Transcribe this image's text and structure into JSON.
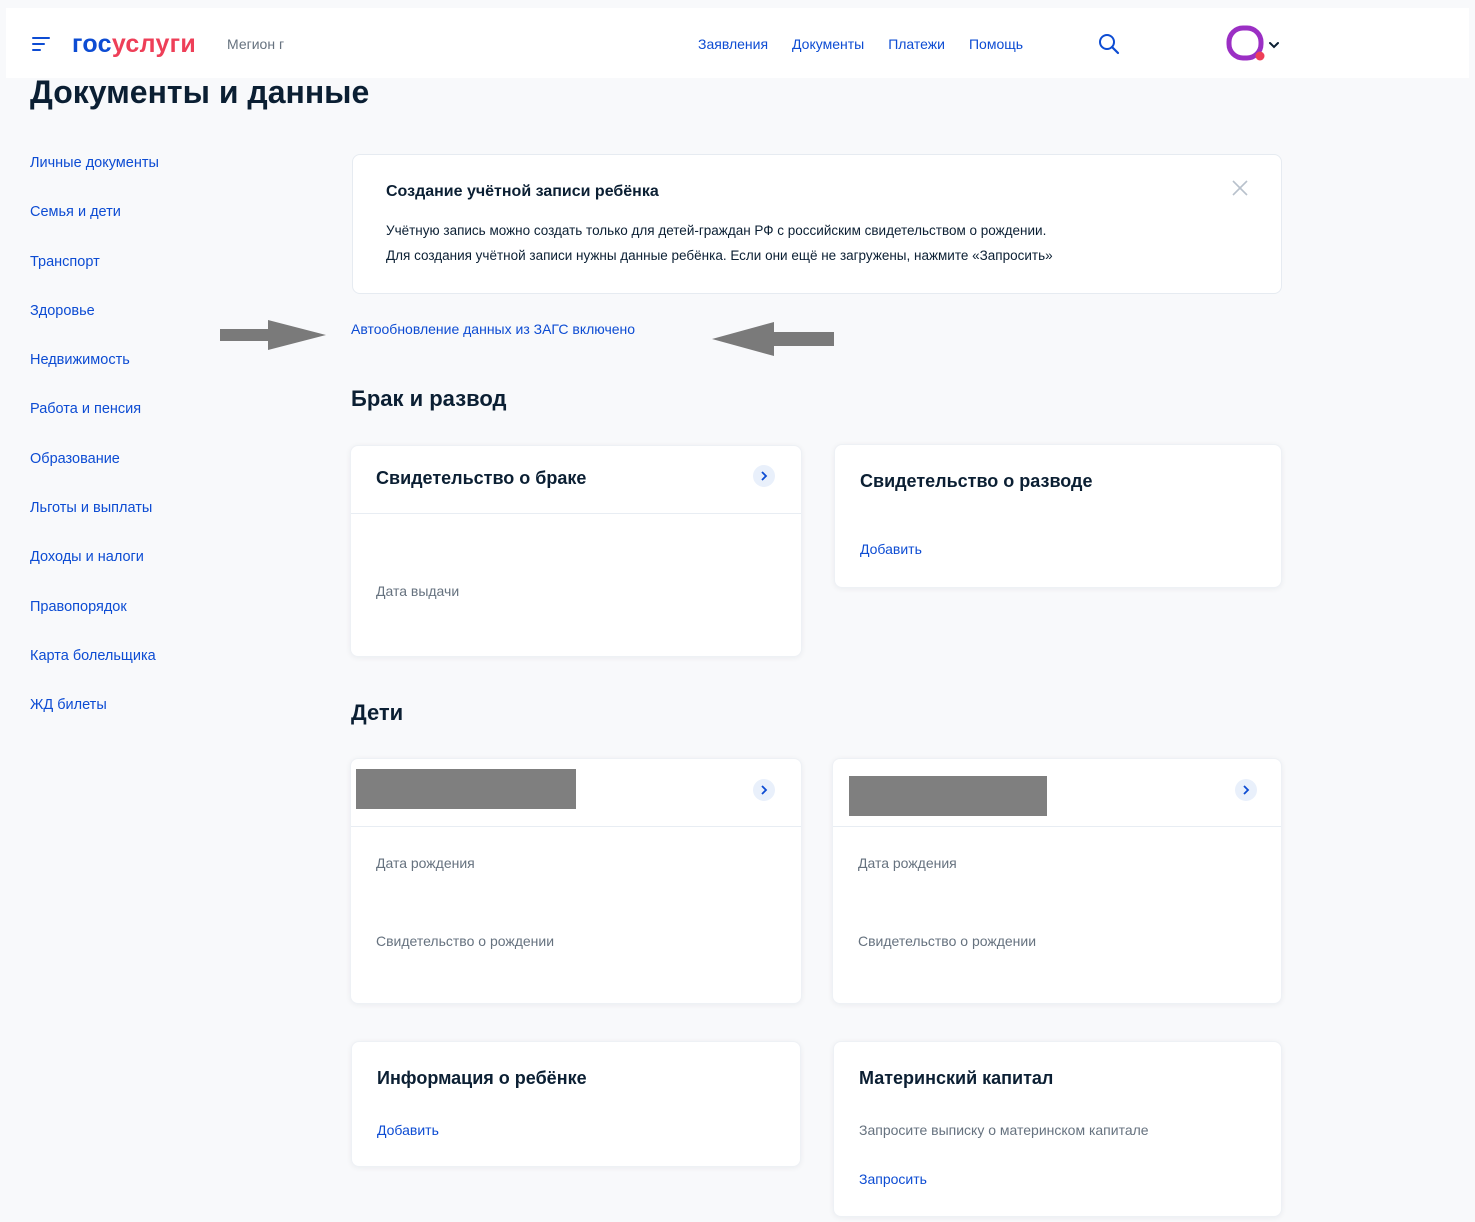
{
  "header": {
    "logo_part1": "гос",
    "logo_part2": "услуги",
    "region": "Мегион г",
    "nav": [
      "Заявления",
      "Документы",
      "Платежи",
      "Помощь"
    ],
    "brand_color": "#0d4cd3",
    "accent_color": "#ee3f58"
  },
  "page_title": "Документы и данные",
  "sidebar": {
    "items": [
      "Личные документы",
      "Семья и дети",
      "Транспорт",
      "Здоровье",
      "Недвижимость",
      "Работа и пенсия",
      "Образование",
      "Льготы и выплаты",
      "Доходы и налоги",
      "Правопорядок",
      "Карта болельщика",
      "ЖД билеты"
    ]
  },
  "notice": {
    "title": "Создание учётной записи ребёнка",
    "line1": "Учётную запись можно создать только для детей-граждан РФ с российским свидетельством о рождении.",
    "line2": "Для создания учётной записи нужны данные ребёнка. Если они ещё не загружены, нажмите «Запросить»"
  },
  "autoupdate": "Автообновление данных из ЗАГС включено",
  "marriage": {
    "section_title": "Брак и развод",
    "marriage_card": {
      "title": "Свидетельство о браке",
      "issue_date_label": "Дата выдачи"
    },
    "divorce_card": {
      "title": "Свидетельство о разводе",
      "add_link": "Добавить"
    }
  },
  "children": {
    "section_title": "Дети",
    "child_cards": [
      {
        "birth_date_label": "Дата рождения",
        "certificate_label": "Свидетельство о рождении"
      },
      {
        "birth_date_label": "Дата рождения",
        "certificate_label": "Свидетельство о рождении"
      }
    ],
    "child_info_card": {
      "title": "Информация о ребёнке",
      "add_link": "Добавить"
    },
    "maternity_card": {
      "title": "Материнский капитал",
      "text": "Запросите выписку о материнском капитале",
      "request_link": "Запросить"
    }
  }
}
